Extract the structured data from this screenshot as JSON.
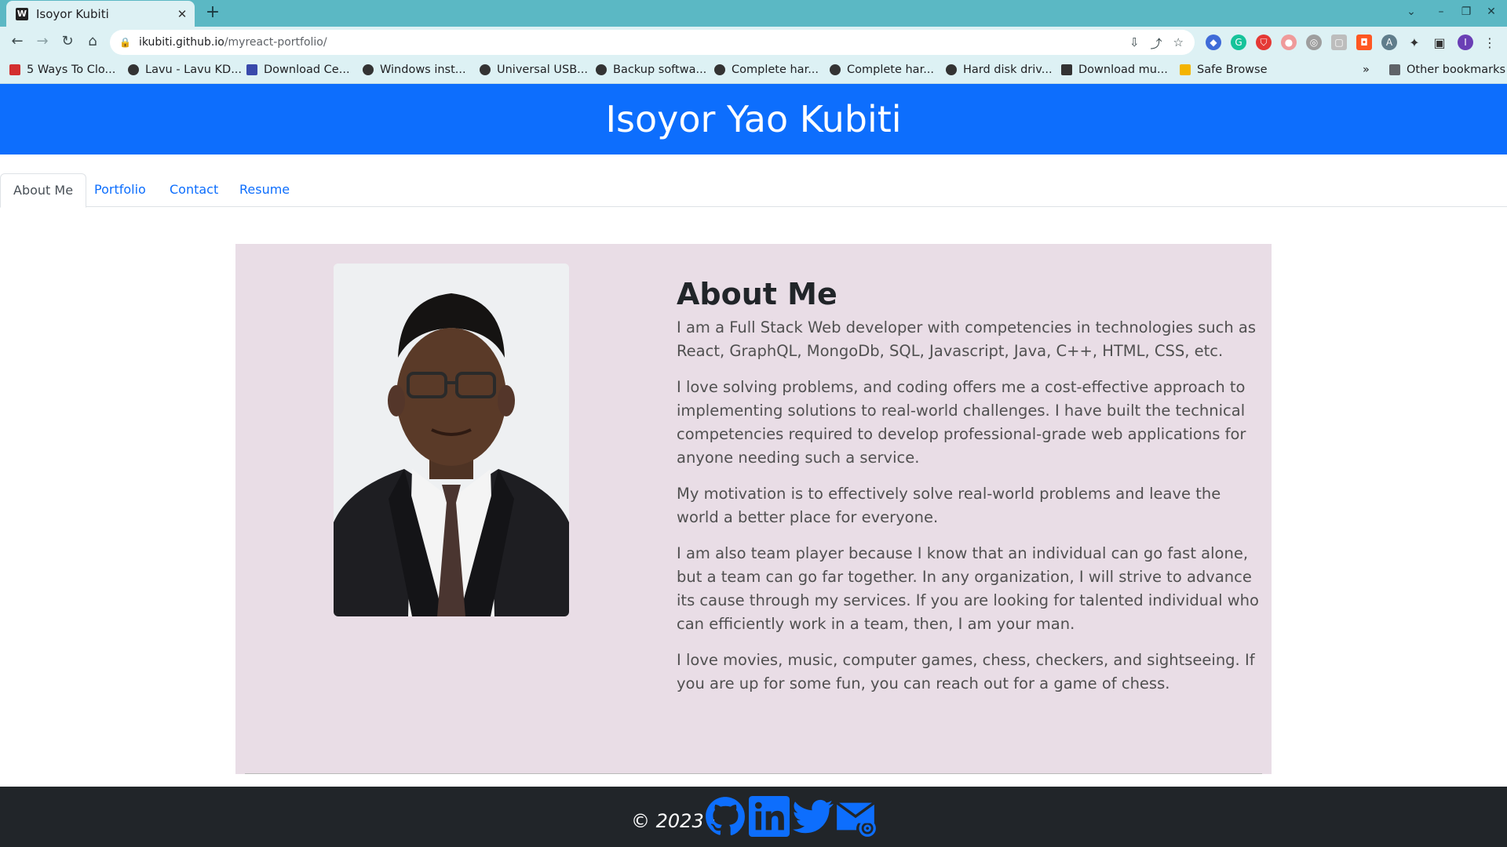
{
  "browser": {
    "tab_title": "Isoyor Kubiti",
    "url_host": "ikubiti.github.io",
    "url_path": "/myreact-portfolio/",
    "profile_initial": "I",
    "bookmarks": [
      "5 Ways To Clo...",
      "Lavu - Lavu KD...",
      "Download Ce...",
      "Windows inst...",
      "Universal USB...",
      "Backup softwa...",
      "Complete har...",
      "Complete har...",
      "Hard disk driv...",
      "Download mu...",
      "Safe Browse"
    ],
    "overflow_label": "»",
    "other_bookmarks": "Other bookmarks"
  },
  "page": {
    "header_title": "Isoyor Yao Kubiti",
    "nav": [
      "About Me",
      "Portfolio",
      "Contact",
      "Resume"
    ],
    "about": {
      "heading": "About Me",
      "paragraphs": [
        "I am a Full Stack Web developer with competencies in technologies such as React, GraphQL, MongoDb, SQL, Javascript, Java, C++, HTML, CSS, etc.",
        "I love solving problems, and coding offers me a cost-effective approach to implementing solutions to real-world challenges. I have built the technical competencies required to develop professional-grade web applications for anyone needing such a service.",
        "My motivation is to effectively solve real-world problems and leave the world a better place for everyone.",
        "I am also team player because I know that an individual can go fast alone, but a team can go far together. In any organization, I will strive to advance its cause through my services. If you are looking for talented individual who can efficiently work in a team, then, I am your man.",
        "I love movies, music, computer games, chess, checkers, and sightseeing. If you are up for some fun, you can reach out for a game of chess."
      ]
    },
    "footer": {
      "copyright": "© 2023 ·",
      "icons": [
        "github-icon",
        "linkedin-icon",
        "twitter-icon",
        "email-icon"
      ]
    }
  },
  "colors": {
    "header_bg": "#0d6efd",
    "card_bg": "#e9dde6",
    "footer_bg": "#212529",
    "tabstrip_bg": "#5bb8c4",
    "toolbar_bg": "#ddf1f4"
  }
}
